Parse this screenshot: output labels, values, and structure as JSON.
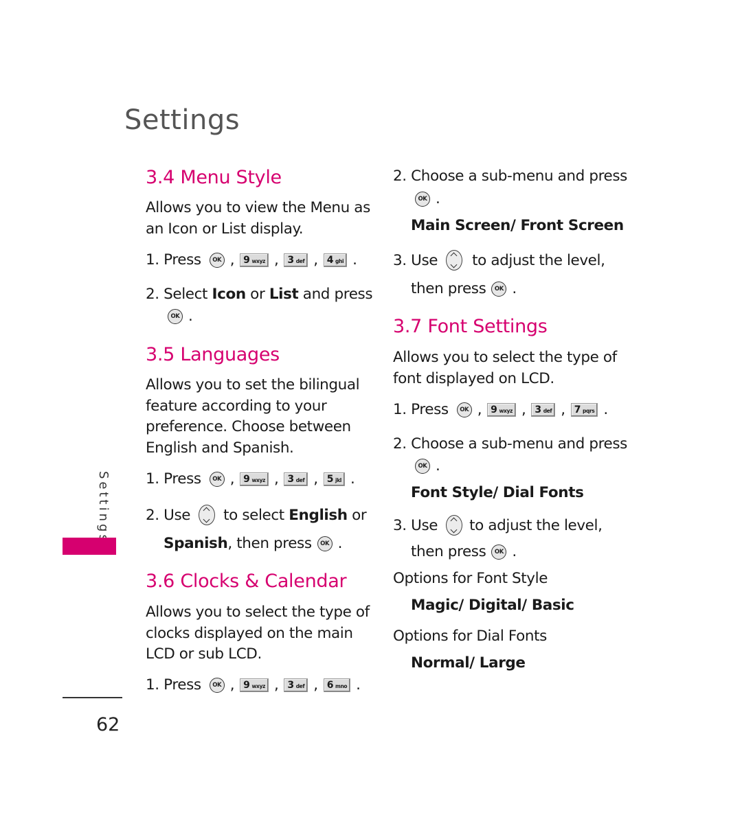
{
  "page": {
    "title": "Settings",
    "side_tab_label": "Settings",
    "page_number": "62",
    "accent_color": "#d6006f"
  },
  "icons": {
    "ok": "OK",
    "navigation": "navigation-key-up-down"
  },
  "sections": {
    "menu_style": {
      "heading": "3.4 Menu Style",
      "description_lines": [
        "Allows you to view the Menu as",
        "an Icon or List display."
      ],
      "step1_prefix": "1. Press",
      "step1_keys": [
        {
          "num": "9",
          "letters": "wxyz"
        },
        {
          "num": "3",
          "letters": "def"
        },
        {
          "num": "4",
          "letters": "ghi"
        }
      ],
      "step2_prefix": "2. Select ",
      "step2_bold1": "Icon",
      "step2_mid": " or ",
      "step2_bold2": "List",
      "step2_suffix": " and press"
    },
    "languages": {
      "heading": "3.5 Languages",
      "description_lines": [
        "Allows you to set the bilingual",
        "feature according to your",
        "preference. Choose between",
        "English and Spanish."
      ],
      "step1_prefix": "1. Press",
      "step1_keys": [
        {
          "num": "9",
          "letters": "wxyz"
        },
        {
          "num": "3",
          "letters": "def"
        },
        {
          "num": "5",
          "letters": "jkl"
        }
      ],
      "step2_prefix": "2. Use",
      "step2_mid": "to select ",
      "step2_bold1": "English",
      "step2_suffix": " or",
      "step2_line2_bold": "Spanish",
      "step2_line2_suffix": ", then press"
    },
    "clocks_calendar": {
      "heading": "3.6 Clocks & Calendar",
      "description_lines": [
        "Allows you to select the type of",
        "clocks displayed on the main",
        "LCD or sub LCD."
      ],
      "step1_prefix": "1. Press",
      "step1_keys": [
        {
          "num": "9",
          "letters": "wxyz"
        },
        {
          "num": "3",
          "letters": "def"
        },
        {
          "num": "6",
          "letters": "mno"
        }
      ]
    },
    "clocks_continued": {
      "step2": "2. Choose a sub-menu and press",
      "options": "Main Screen/ Front Screen",
      "step3_prefix": "3. Use",
      "step3_suffix": "to adjust the level,",
      "step3_line2": "then press"
    },
    "font_settings": {
      "heading": "3.7 Font Settings",
      "description_lines": [
        "Allows you to select the type of",
        "font displayed on LCD."
      ],
      "step1_prefix": "1. Press",
      "step1_keys": [
        {
          "num": "9",
          "letters": "wxyz"
        },
        {
          "num": "3",
          "letters": "def"
        },
        {
          "num": "7",
          "letters": "pqrs"
        }
      ],
      "step2": "2. Choose a sub-menu and press",
      "options": "Font Style/ Dial Fonts",
      "step3_prefix": "3. Use",
      "step3_suffix": "to adjust the level,",
      "step3_line2": "then press",
      "font_style_label": "Options for Font Style",
      "font_style_options": "Magic/ Digital/ Basic",
      "dial_fonts_label": "Options for Dial Fonts",
      "dial_fonts_options": "Normal/ Large"
    }
  }
}
